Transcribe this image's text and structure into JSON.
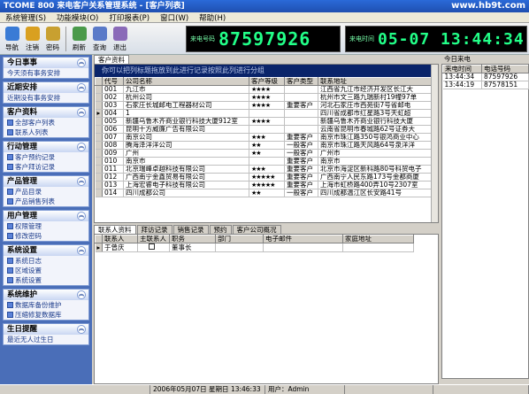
{
  "window": {
    "title": "TCOME 800 来电客户关系管理系统 - [客户列表]",
    "watermark": "www.hb9t.com"
  },
  "menu": [
    "系统管理(S)",
    "功能模块(O)",
    "打印报表(P)",
    "窗口(W)",
    "帮助(H)"
  ],
  "toolbar": [
    {
      "label": "导航",
      "icon": "navigate-icon",
      "color": "#3a7bd5"
    },
    {
      "label": "注销",
      "icon": "logout-icon",
      "color": "#d9a020"
    },
    {
      "label": "密码",
      "icon": "key-icon",
      "color": "#c8a030"
    },
    {
      "label": "刷新",
      "icon": "refresh-icon",
      "color": "#4a9a4a"
    },
    {
      "label": "查询",
      "icon": "query-icon",
      "color": "#5a7ac8"
    },
    {
      "label": "退出",
      "icon": "exit-icon",
      "color": "#8a6ab8"
    }
  ],
  "led": {
    "phone_label": "来电号码",
    "phone": "87597926",
    "time_label": "来电时间",
    "time": "05-07 13:44:34"
  },
  "sidebar": [
    {
      "title": "今日事事",
      "items": [
        "今天须有事务安排"
      ],
      "plain": true
    },
    {
      "title": "近期安排",
      "items": [
        "近期没有事务安排"
      ],
      "plain": true
    },
    {
      "title": "客户资料",
      "items": [
        "全部客户列表",
        "联系人列表"
      ]
    },
    {
      "title": "行动管理",
      "items": [
        "客户预约记录",
        "客户拜访记录"
      ]
    },
    {
      "title": "产品管理",
      "items": [
        "产品目录",
        "产品销售列表"
      ]
    },
    {
      "title": "用户管理",
      "items": [
        "权限管理",
        "修改密码"
      ]
    },
    {
      "title": "系统设置",
      "items": [
        "系统日志",
        "区域设置",
        "系统设置"
      ]
    },
    {
      "title": "系统维护",
      "items": [
        "数据库备份维护",
        "压缩修复数据库"
      ]
    },
    {
      "title": "生日提醒",
      "items": [
        "最近无人过生日"
      ],
      "plain": true
    }
  ],
  "tab_customer": "客户资料",
  "group_hint": "你可以把列标题拖放到此进行记录按照此列进行分组",
  "customer_table": {
    "columns": [
      "代号",
      "公司名称",
      "客户等级",
      "客户类型",
      "联系地址"
    ],
    "rows": [
      [
        "001",
        "九江市",
        "★★★★",
        "",
        "江西省九江市经济开发区长江大"
      ],
      [
        "002",
        "杭州公司",
        "★★★★",
        "",
        "杭州市文三路九瑞新村19幢97单"
      ],
      [
        "003",
        "石家庄长城邮电工程器材公司",
        "★★★★",
        "重要客户",
        "河北石家庄市西苑街7号省邮电"
      ],
      [
        "004",
        "1",
        "",
        "",
        "四川省成都市红星路3号天虹超"
      ],
      [
        "005",
        "新疆乌鲁木齐商业银行科技大厦912室",
        "★★★★",
        "",
        "新疆乌鲁木齐商业银行科技大厦"
      ],
      [
        "006",
        "昆明十方威廉广告有限公司",
        "",
        "",
        "云南省昆明市春城路62号证券大"
      ],
      [
        "007",
        "南京公司",
        "★★★",
        "重要客户",
        "南京市珠江路350号银鸿商业中心"
      ],
      [
        "008",
        "腾海泽洋洋公司",
        "★★",
        "一般客户",
        "南京市珠江路天风路64号泉洋洋"
      ],
      [
        "009",
        "广州",
        "★★",
        "一般客户",
        "广州市"
      ],
      [
        "010",
        "南京市",
        "",
        "重要客户",
        "南京市"
      ],
      [
        "011",
        "北京瑞峰卓越科技有限公司",
        "★★★",
        "重要客户",
        "北京市海淀区新科路80号科贸电子"
      ],
      [
        "012",
        "广西南宁金鑫贸易有限公司",
        "★★★★★",
        "重要客户",
        "广西南宁人民东路173号金都商厦"
      ],
      [
        "013",
        "上海宏睿电子科技有限公司",
        "★★★★★",
        "重要客户",
        "上海市虹桥路400弄10号2307室"
      ],
      [
        "014",
        "四川成都公司",
        "★★",
        "一般客户",
        "四川成都温江区长安路41号"
      ]
    ]
  },
  "lower_tabs": [
    "联系人资料",
    "拜访记录",
    "销售记录",
    "预约",
    "客户公司概况"
  ],
  "contact_table": {
    "columns": [
      "联系人",
      "主联系人",
      "职务",
      "部门",
      "电子邮件",
      "家庭地址"
    ],
    "rows": [
      [
        "于曾庆",
        "",
        "董事长",
        "",
        "",
        ""
      ]
    ]
  },
  "right_panel": {
    "title": "今日来电",
    "columns": [
      "来电时间",
      "电话号码"
    ],
    "rows": [
      [
        "13:44:34",
        "87597926"
      ],
      [
        "13:44:19",
        "87578151"
      ]
    ]
  },
  "status": [
    "",
    "2006年05月07日 星期日 13:46:33",
    "用户：Admin",
    "",
    ""
  ]
}
